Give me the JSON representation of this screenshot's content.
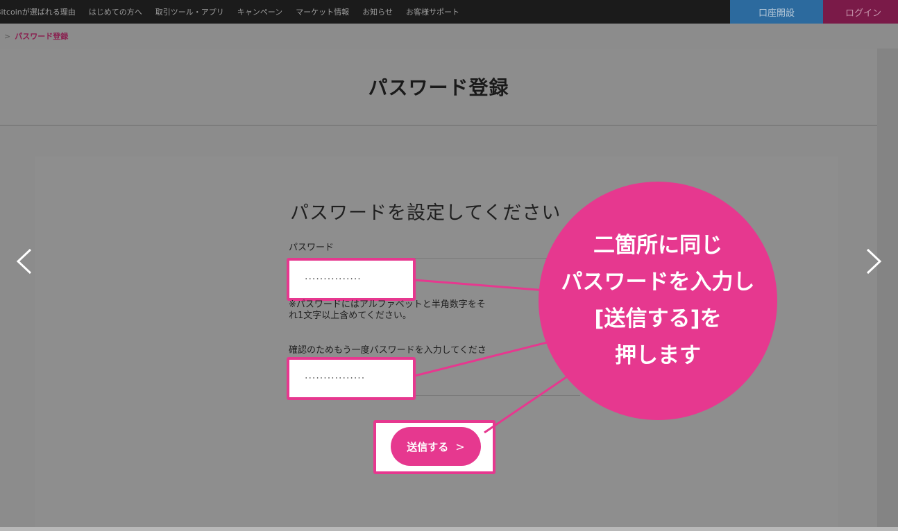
{
  "nav": {
    "items": [
      "Bitcoinが選ばれる理由",
      "はじめての方へ",
      "取引ツール・アプリ",
      "キャンペーン",
      "マーケット情報",
      "お知らせ",
      "お客様サポート"
    ],
    "open_account_label": "口座開設",
    "login_label": "ログイン"
  },
  "breadcrumb": {
    "separator": ">",
    "current": "パスワード登録"
  },
  "page_title": "パスワード登録",
  "form": {
    "heading": "パスワードを設定してください",
    "password_label": "パスワード",
    "password_value": "···············",
    "note_line1": "※パスワードにはアルファベットと半角数字をそ",
    "note_line2": "れ1文字以上含めてください。",
    "confirm_label": "確認のためもう一度パスワードを入力してくださ",
    "confirm_value": "················",
    "submit_label": "送信する",
    "submit_chevron": ">"
  },
  "callout": {
    "lines": [
      "二箇所に同じ",
      "パスワードを入力し",
      "[送信する]を",
      "押します"
    ]
  },
  "carousel": {
    "prev_icon": "chevron-left-icon",
    "next_icon": "chevron-right-icon"
  },
  "colors": {
    "accent": "#e6388f",
    "overlay": "#8c8c8c",
    "nav_bg": "#1b1b1b"
  }
}
